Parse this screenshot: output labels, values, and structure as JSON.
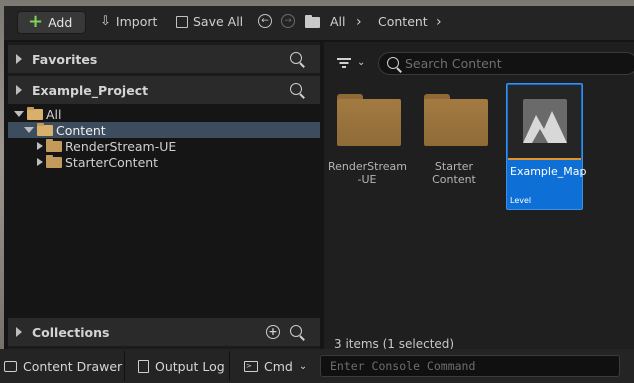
{
  "toolbar": {
    "add_label": "Add",
    "import_label": "Import",
    "save_all_label": "Save All",
    "breadcrumb": [
      "All",
      "Content"
    ]
  },
  "sidebar": {
    "favorites_label": "Favorites",
    "project_label": "Example_Project",
    "tree": [
      {
        "label": "All",
        "expanded": true,
        "selected": false
      },
      {
        "label": "Content",
        "expanded": true,
        "selected": true
      },
      {
        "label": "RenderStream-UE",
        "expanded": false,
        "selected": false
      },
      {
        "label": "StarterContent",
        "expanded": false,
        "selected": false
      }
    ],
    "collections_label": "Collections"
  },
  "content": {
    "search_placeholder": "Search Content",
    "items": [
      {
        "label": "RenderStream\n-UE",
        "kind": "folder"
      },
      {
        "label": "Starter\nContent",
        "kind": "folder"
      },
      {
        "label": "Example_Map",
        "kind": "level",
        "type_label": "Level",
        "selected": true
      }
    ],
    "status": "3 items (1 selected)"
  },
  "bottom_bar": {
    "content_drawer_label": "Content Drawer",
    "output_log_label": "Output Log",
    "cmd_label": "Cmd",
    "console_placeholder": "Enter Console Command"
  },
  "colors": {
    "accent_blue": "#0e70d6",
    "folder": "#a37a41",
    "add_green": "#7fd15a"
  }
}
